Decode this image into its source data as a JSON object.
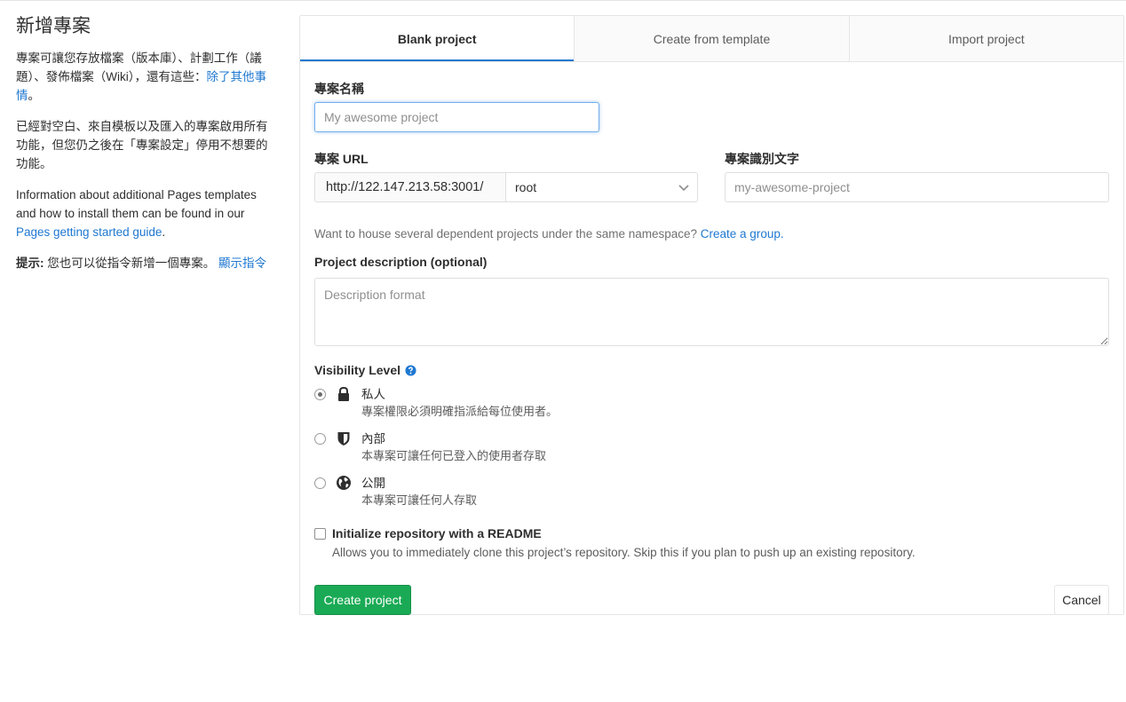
{
  "sidebar": {
    "title": "新增專案",
    "intro_text": "專案可讓您存放檔案（版本庫）、計劃工作（議題）、發佈檔案（Wiki），還有這些：",
    "intro_link": "除了其他事情",
    "intro_end": "。",
    "features_text": "已經對空白、來自模板以及匯入的專案啟用所有功能，但您仍之後在「專案設定」停用不想要的功能。",
    "pages_text": "Information about additional Pages templates and how to install them can be found in our ",
    "pages_link": "Pages getting started guide",
    "pages_end": ".",
    "tip_label": "提示:",
    "tip_text": " 您也可以從指令新增一個專案。 ",
    "tip_link": "顯示指令"
  },
  "tabs": [
    {
      "label": "Blank project",
      "active": true
    },
    {
      "label": "Create from template",
      "active": false
    },
    {
      "label": "Import project",
      "active": false
    }
  ],
  "form": {
    "name_label": "專案名稱",
    "name_placeholder": "My awesome project",
    "url_label": "專案 URL",
    "url_prefix": "http://122.147.213.58:3001/",
    "namespace_value": "root",
    "slug_label": "專案識別文字",
    "slug_placeholder": "my-awesome-project",
    "group_help": "Want to house several dependent projects under the same namespace? ",
    "group_link": "Create a group.",
    "description_label": "Project description (optional)",
    "description_placeholder": "Description format",
    "visibility_label": "Visibility Level",
    "visibility_options": [
      {
        "title": "私人",
        "desc": "專案權限必須明確指派給每位使用者。",
        "icon": "lock-icon",
        "checked": true
      },
      {
        "title": "內部",
        "desc": "本專案可讓任何已登入的使用者存取",
        "icon": "shield-icon",
        "checked": false
      },
      {
        "title": "公開",
        "desc": "本專案可讓任何人存取",
        "icon": "globe-icon",
        "checked": false
      }
    ],
    "readme_label": "Initialize repository with a README",
    "readme_help": "Allows you to immediately clone this project’s repository. Skip this if you plan to push up an existing repository."
  },
  "actions": {
    "create_label": "Create project",
    "cancel_label": "Cancel"
  },
  "colors": {
    "accent": "#1f78d1",
    "success": "#1aaa55"
  }
}
